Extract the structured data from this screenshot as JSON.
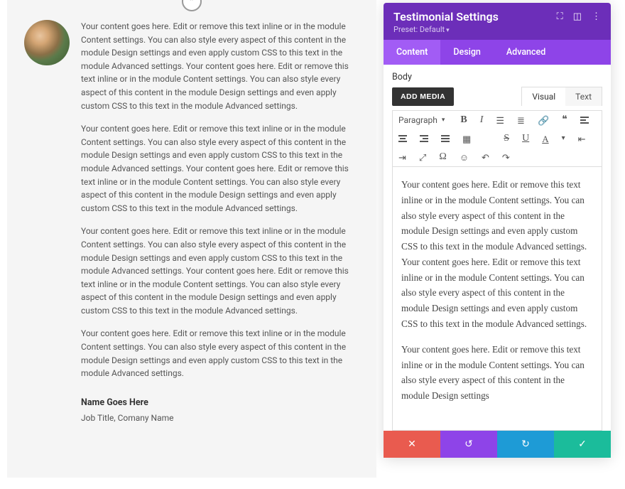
{
  "testimonial": {
    "paragraph": "Your content goes here. Edit or remove this text inline or in the module Content settings. You can also style every aspect of this content in the module Design settings and even apply custom CSS to this text in the module Advanced settings. Your content goes here. Edit or remove this text inline or in the module Content settings. You can also style every aspect of this content in the module Design settings and even apply custom CSS to this text in the module Advanced settings.",
    "paragraph_short": "Your content goes here. Edit or remove this text inline or in the module Content settings. You can also style every aspect of this content in the module Design settings and even apply custom CSS to this text in the module Advanced settings.",
    "author_name": "Name Goes Here",
    "author_job": "Job Title, Comany Name"
  },
  "panel": {
    "title": "Testimonial Settings",
    "preset_label": "Preset: Default",
    "tabs": {
      "content": "Content",
      "design": "Design",
      "advanced": "Advanced"
    },
    "body_label": "Body",
    "add_media": "ADD MEDIA",
    "editor_tabs": {
      "visual": "Visual",
      "text": "Text"
    },
    "format_select": "Paragraph",
    "editor_p1": "Your content goes here. Edit or remove this text inline or in the module Content settings. You can also style every aspect of this content in the module Design settings and even apply custom CSS to this text in the module Advanced settings. Your content goes here. Edit or remove this text inline or in the module Content settings. You can also style every aspect of this content in the module Design settings and even apply custom CSS to this text in the module Advanced settings.",
    "editor_p2": "Your content goes here. Edit or remove this text inline or in the module Content settings. You can also style every aspect of this content in the module Design settings"
  },
  "colors": {
    "header": "#6c2eb9",
    "tabs_bg": "#8e44e8",
    "cancel": "#e95b4f",
    "undo": "#8e44e8",
    "redo": "#1e9bd6",
    "save": "#1bbc9b"
  }
}
